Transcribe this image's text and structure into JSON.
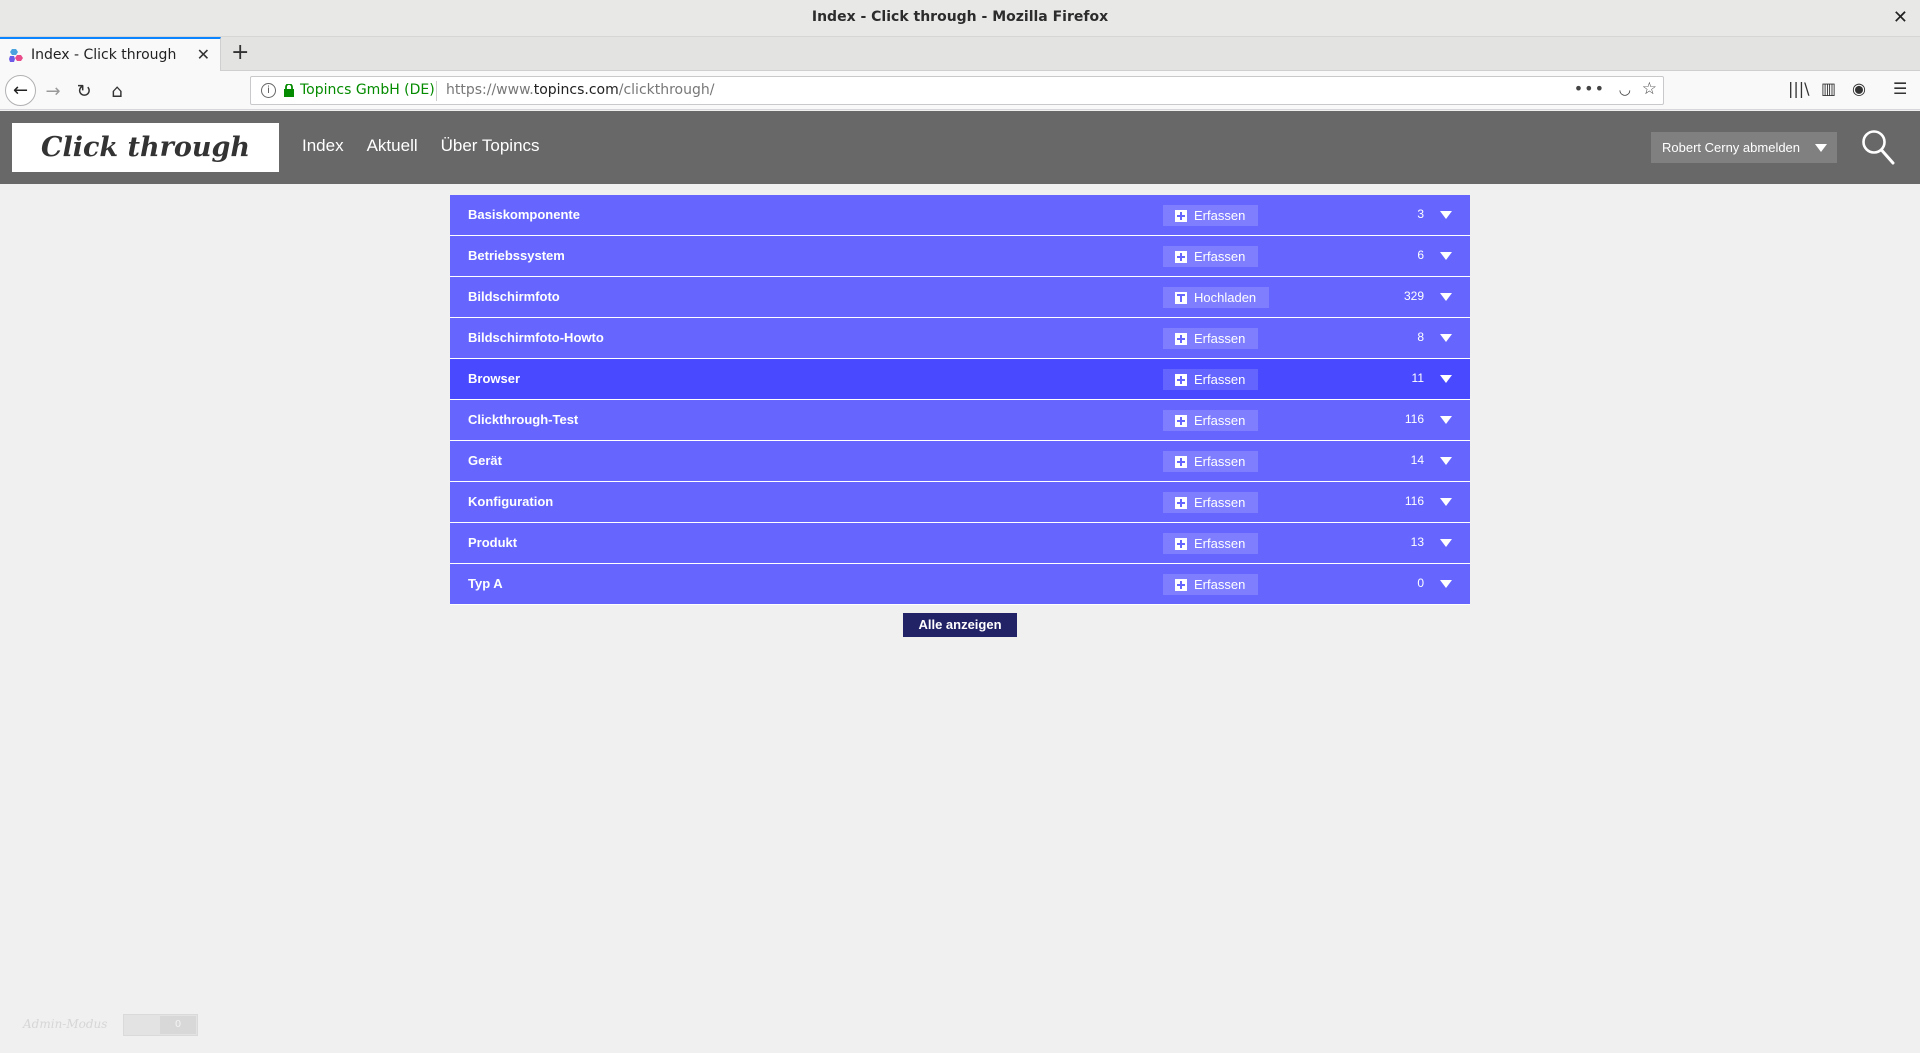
{
  "window": {
    "title": "Index - Click through - Mozilla Firefox"
  },
  "tab": {
    "label": "Index - Click through"
  },
  "urlbar": {
    "org": "Topincs GmbH (DE)",
    "url_prefix": "https://www.",
    "url_domain": "topincs.com",
    "url_path": "/clickthrough/"
  },
  "site": {
    "logo": "Click through",
    "nav": [
      "Index",
      "Aktuell",
      "Über Topincs"
    ],
    "user_menu": "Robert Cerny abmelden"
  },
  "types": [
    {
      "name": "Basiskomponente",
      "action": "Erfassen",
      "action_icon": "plus-icon",
      "count": "3"
    },
    {
      "name": "Betriebssystem",
      "action": "Erfassen",
      "action_icon": "plus-icon",
      "count": "6"
    },
    {
      "name": "Bildschirmfoto",
      "action": "Hochladen",
      "action_icon": "upload-icon",
      "count": "329"
    },
    {
      "name": "Bildschirmfoto-Howto",
      "action": "Erfassen",
      "action_icon": "plus-icon",
      "count": "8"
    },
    {
      "name": "Browser",
      "action": "Erfassen",
      "action_icon": "plus-icon",
      "count": "11"
    },
    {
      "name": "Clickthrough-Test",
      "action": "Erfassen",
      "action_icon": "plus-icon",
      "count": "116"
    },
    {
      "name": "Gerät",
      "action": "Erfassen",
      "action_icon": "plus-icon",
      "count": "14"
    },
    {
      "name": "Konfiguration",
      "action": "Erfassen",
      "action_icon": "plus-icon",
      "count": "116"
    },
    {
      "name": "Produkt",
      "action": "Erfassen",
      "action_icon": "plus-icon",
      "count": "13"
    },
    {
      "name": "Typ A",
      "action": "Erfassen",
      "action_icon": "plus-icon",
      "count": "0"
    }
  ],
  "show_all": "Alle anzeigen",
  "admin": {
    "label": "Admin-Modus",
    "toggle_text": "0"
  },
  "colors": {
    "row": "#6666ff",
    "row_active": "#4949ff",
    "header": "#686868",
    "button_dark": "#222266"
  }
}
